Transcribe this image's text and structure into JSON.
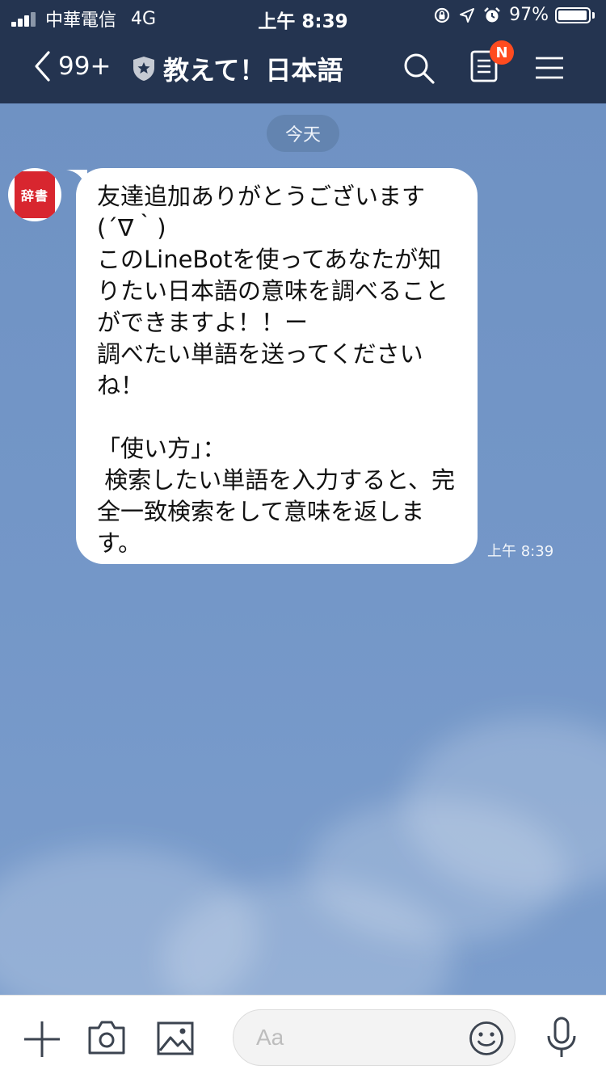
{
  "status_bar": {
    "carrier": "中華電信",
    "network": "4G",
    "time": "上午 8:39",
    "battery": "97%",
    "battery_level": 0.97
  },
  "nav": {
    "back_count": "99+",
    "title": "教えて！日本語",
    "notes_badge": "N",
    "icons": [
      "back-chevron-icon",
      "shield-star-icon",
      "search-icon",
      "notes-icon",
      "menu-icon"
    ]
  },
  "chat": {
    "date_label": "今天",
    "avatar_text": "辞書",
    "messages": [
      {
        "text": "友達追加ありがとうございます (´∇｀)\nこのLineBotを使ってあなたが知りたい日本語の意味を調べることができますよ！！ー\n調べたい単語を送ってくださいね！\n\n「使い方」：\n 検索したい単語を入力すると、完全一致検索をして意味を返します。",
        "time": "上午 8:39"
      }
    ]
  },
  "input_bar": {
    "placeholder": "Aa",
    "icons": [
      "plus-icon",
      "camera-icon",
      "image-icon",
      "emoji-icon",
      "microphone-icon"
    ]
  },
  "colors": {
    "header_bg": "#243450",
    "chat_bg": "#7195c6",
    "badge": "#ff4b1f",
    "avatar_book": "#d8262f"
  }
}
